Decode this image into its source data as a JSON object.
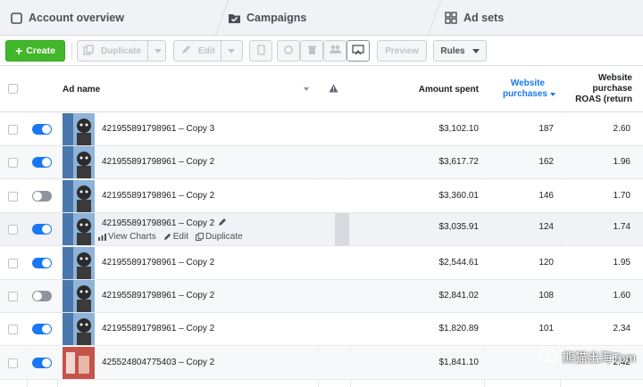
{
  "tabs": [
    {
      "label": "Account overview",
      "icon": "square-icon"
    },
    {
      "label": "Campaigns",
      "icon": "folder-check-icon"
    },
    {
      "label": "Ad sets",
      "icon": "grid-icon"
    }
  ],
  "toolbar": {
    "create_label": "Create",
    "duplicate_label": "Duplicate",
    "edit_label": "Edit",
    "preview_label": "Preview",
    "rules_label": "Rules"
  },
  "table": {
    "columns": {
      "ad_name": "Ad name",
      "amount_spent": "Amount spent",
      "website_purchases_line1": "Website",
      "website_purchases_line2": "purchases",
      "roas_line1": "Website",
      "roas_line2": "purchase",
      "roas_line3": "ROAS (return"
    },
    "rows": [
      {
        "name": "421955891798961 – Copy 3",
        "spent": "$3,102.10",
        "purchases": "187",
        "roas": "2.60",
        "on": true
      },
      {
        "name": "421955891798961 – Copy 2",
        "spent": "$3,617.72",
        "purchases": "162",
        "roas": "1.96",
        "on": true
      },
      {
        "name": "421955891798961 – Copy 2",
        "spent": "$3,360.01",
        "purchases": "146",
        "roas": "1.70",
        "on": false
      },
      {
        "name": "421955891798961 – Copy 2",
        "spent": "$3,035.91",
        "purchases": "124",
        "roas": "1.74",
        "on": true
      },
      {
        "name": "421955891798961 – Copy 2",
        "spent": "$2,544.61",
        "purchases": "120",
        "roas": "1.95",
        "on": true
      },
      {
        "name": "421955891798961 – Copy 2",
        "spent": "$2,841.02",
        "purchases": "108",
        "roas": "1.60",
        "on": false
      },
      {
        "name": "421955891798961 – Copy 2",
        "spent": "$1,820.89",
        "purchases": "101",
        "roas": "2.34",
        "on": true
      },
      {
        "name": "425524804775403 – Copy 2",
        "spent": "$1,841.10",
        "purchases": "",
        "roas": "2.42",
        "on": true
      }
    ],
    "row_actions": {
      "view_charts": "View Charts",
      "edit": "Edit",
      "duplicate": "Duplicate"
    }
  },
  "watermark": {
    "text": "熊猫出海Tom"
  },
  "colors": {
    "accent": "#1877f2",
    "create": "#42b72a",
    "sorted_header": "#1877f2"
  }
}
